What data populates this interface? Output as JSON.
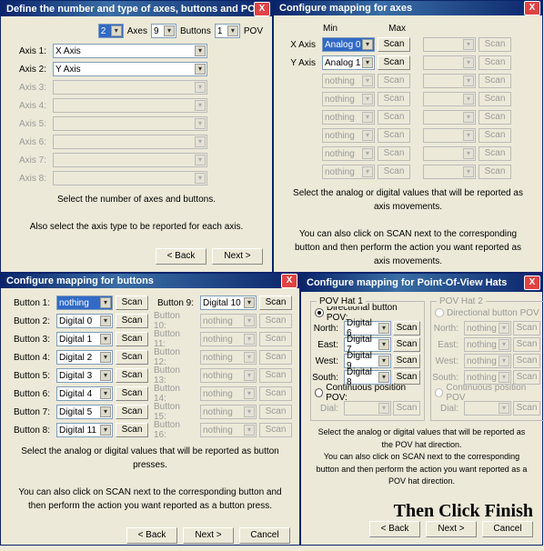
{
  "common": {
    "back": "< Back",
    "next": "Next >",
    "cancel": "Cancel",
    "scan": "Scan",
    "close": "X"
  },
  "d1": {
    "title": "Define the number and type of axes, buttons and POV h",
    "top": {
      "axes_val": "2",
      "axes_label": "Axes",
      "buttons_val": "9",
      "buttons_label": "Buttons",
      "pov_val": "1",
      "pov_label": "POV"
    },
    "axes": [
      {
        "label": "Axis 1:",
        "val": "X Axis",
        "enabled": true
      },
      {
        "label": "Axis 2:",
        "val": "Y Axis",
        "enabled": true
      },
      {
        "label": "Axis 3:",
        "val": "",
        "enabled": false
      },
      {
        "label": "Axis 4:",
        "val": "",
        "enabled": false
      },
      {
        "label": "Axis 5:",
        "val": "",
        "enabled": false
      },
      {
        "label": "Axis 6:",
        "val": "",
        "enabled": false
      },
      {
        "label": "Axis 7:",
        "val": "",
        "enabled": false
      },
      {
        "label": "Axis 8:",
        "val": "",
        "enabled": false
      }
    ],
    "help1": "Select the number of axes and buttons.",
    "help2": "Also select the axis type to be reported for each axis."
  },
  "d2": {
    "title": "Configure mapping for axes",
    "min": "Min",
    "max": "Max",
    "rows": [
      {
        "label": "X Axis",
        "min_val": "Analog 0",
        "min_hl": true,
        "max_val": "",
        "enabled": true
      },
      {
        "label": "Y Axis",
        "min_val": "Analog 1",
        "min_hl": false,
        "max_val": "",
        "enabled": true
      },
      {
        "label": "",
        "min_val": "nothing",
        "min_hl": false,
        "max_val": "",
        "enabled": false
      },
      {
        "label": "",
        "min_val": "nothing",
        "min_hl": false,
        "max_val": "",
        "enabled": false
      },
      {
        "label": "",
        "min_val": "nothing",
        "min_hl": false,
        "max_val": "",
        "enabled": false
      },
      {
        "label": "",
        "min_val": "nothing",
        "min_hl": false,
        "max_val": "",
        "enabled": false
      },
      {
        "label": "",
        "min_val": "nothing",
        "min_hl": false,
        "max_val": "",
        "enabled": false
      },
      {
        "label": "",
        "min_val": "nothing",
        "min_hl": false,
        "max_val": "",
        "enabled": false
      }
    ],
    "help1": "Select the analog or digital values that will be reported as axis movements.",
    "help2": "You can also click on SCAN next to the corresponding button and then perform the action you want reported as axis movements."
  },
  "d3": {
    "title": "Configure mapping for buttons",
    "left": [
      {
        "label": "Button 1:",
        "val": "nothing",
        "hl": true,
        "enabled": true
      },
      {
        "label": "Button 2:",
        "val": "Digital 0",
        "hl": false,
        "enabled": true
      },
      {
        "label": "Button 3:",
        "val": "Digital 1",
        "hl": false,
        "enabled": true
      },
      {
        "label": "Button 4:",
        "val": "Digital 2",
        "hl": false,
        "enabled": true
      },
      {
        "label": "Button 5:",
        "val": "Digital 3",
        "hl": false,
        "enabled": true
      },
      {
        "label": "Button 6:",
        "val": "Digital 4",
        "hl": false,
        "enabled": true
      },
      {
        "label": "Button 7:",
        "val": "Digital 5",
        "hl": false,
        "enabled": true
      },
      {
        "label": "Button 8:",
        "val": "Digital 11",
        "hl": false,
        "enabled": true
      }
    ],
    "right": [
      {
        "label": "Button 9:",
        "val": "Digital 10",
        "hl": false,
        "enabled": true
      },
      {
        "label": "Button 10:",
        "val": "nothing",
        "hl": false,
        "enabled": false
      },
      {
        "label": "Button 11:",
        "val": "nothing",
        "hl": false,
        "enabled": false
      },
      {
        "label": "Button 12:",
        "val": "nothing",
        "hl": false,
        "enabled": false
      },
      {
        "label": "Button 13:",
        "val": "nothing",
        "hl": false,
        "enabled": false
      },
      {
        "label": "Button 14:",
        "val": "nothing",
        "hl": false,
        "enabled": false
      },
      {
        "label": "Button 15:",
        "val": "nothing",
        "hl": false,
        "enabled": false
      },
      {
        "label": "Button 16:",
        "val": "nothing",
        "hl": false,
        "enabled": false
      }
    ],
    "help1": "Select the analog or digital values that will be reported as button presses.",
    "help2": "You can also click on SCAN next to the corresponding button and then perform the action you want reported as a button press."
  },
  "d4": {
    "title": "Configure mapping for Point-Of-View Hats",
    "hat1": {
      "name": "POV Hat 1",
      "radio_dir": "Directional button POV:",
      "radio_cont": "Continuous position POV:",
      "enabled": true,
      "dirs": [
        {
          "label": "North:",
          "val": "Digital 6"
        },
        {
          "label": "East:",
          "val": "Digital 7"
        },
        {
          "label": "West:",
          "val": "Digital 9"
        },
        {
          "label": "South:",
          "val": "Digital 8"
        }
      ],
      "dial": {
        "label": "Dial:",
        "val": ""
      }
    },
    "hat2": {
      "name": "POV Hat 2",
      "radio_dir": "Directional button POV",
      "radio_cont": "Continuous position POV",
      "enabled": false,
      "dirs": [
        {
          "label": "North:",
          "val": "nothing"
        },
        {
          "label": "East:",
          "val": "nothing"
        },
        {
          "label": "West:",
          "val": "nothing"
        },
        {
          "label": "South:",
          "val": "nothing"
        }
      ],
      "dial": {
        "label": "Dial:",
        "val": ""
      }
    },
    "help1": "Select the analog or digital values that will be reported as the POV hat direction.",
    "help2": "You can also click on SCAN next to the corresponding button and then perform the action you want reported as a POV hat direction."
  },
  "overlay": "Then Click Finish"
}
